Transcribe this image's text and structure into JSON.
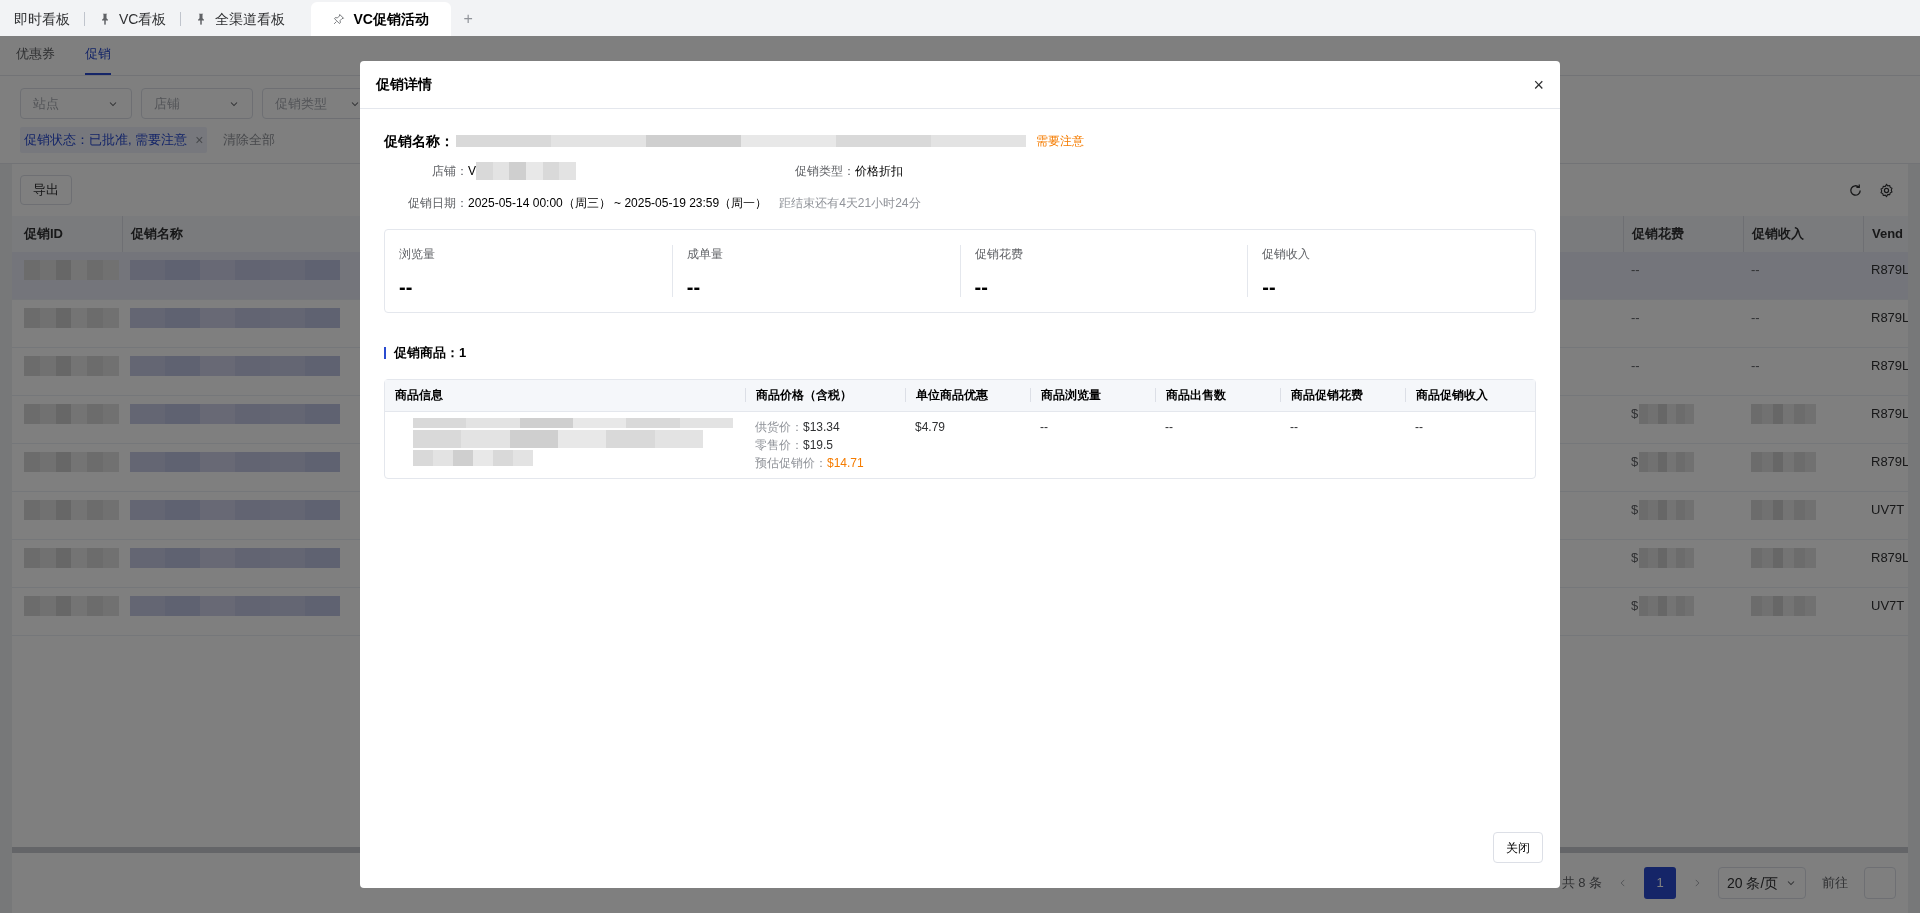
{
  "tabs": [
    {
      "label": "即时看板",
      "selected": false,
      "kind": "plain"
    },
    {
      "label": "VC看板",
      "selected": false,
      "kind": "pinned"
    },
    {
      "label": "全渠道看板",
      "selected": false,
      "kind": "pinned"
    },
    {
      "label": "VC促销活动",
      "selected": true,
      "kind": "unpinned"
    }
  ],
  "add_tab": "+",
  "page": {
    "subtabs": [
      {
        "label": "优惠券",
        "selected": false
      },
      {
        "label": "促销",
        "selected": true
      }
    ],
    "filters": [
      {
        "placeholder": "站点"
      },
      {
        "placeholder": "店铺"
      },
      {
        "placeholder": "促销类型"
      }
    ],
    "active_filter": {
      "text": "促销状态：已批准, 需要注意",
      "remove": "×"
    },
    "clear_all": "清除全部",
    "export": "导出",
    "table": {
      "columns": [
        "促销ID",
        "促销名称",
        "促销花费",
        "促销收入",
        "Vend"
      ],
      "rows": [
        {
          "selected": true,
          "spend": "--",
          "income": "--",
          "vendor": "R879L"
        },
        {
          "selected": false,
          "spend": "--",
          "income": "--",
          "vendor": "R879L"
        },
        {
          "selected": false,
          "spend": "--",
          "income": "--",
          "vendor": "R879L"
        },
        {
          "selected": false,
          "spend": "$",
          "vendor": "R879L"
        },
        {
          "selected": false,
          "spend": "$",
          "vendor": "R879L"
        },
        {
          "selected": false,
          "spend": "$",
          "vendor": "UV7T"
        },
        {
          "selected": false,
          "spend": "$",
          "vendor": "R879L"
        },
        {
          "selected": false,
          "spend": "$",
          "vendor": "UV7T"
        }
      ]
    },
    "pagination": {
      "total": "共 8 条",
      "pages": [
        {
          "label": "1",
          "selected": true
        }
      ],
      "page_size": "20 条/页",
      "goto": "前往"
    }
  },
  "modal": {
    "title": "促销详情",
    "close": "×",
    "name_label": "促销名称：",
    "status": "需要注意",
    "store_label": "店铺：",
    "store_value": "V",
    "type_label": "促销类型：",
    "type_value": "价格折扣",
    "date_label": "促销日期：",
    "date_value": "2025-05-14 00:00（周三） ~ 2025-05-19 23:59（周一）",
    "remaining": "距结束还有4天21小时24分",
    "stats": [
      {
        "label": "浏览量",
        "value": "--"
      },
      {
        "label": "成单量",
        "value": "--"
      },
      {
        "label": "促销花费",
        "value": "--"
      },
      {
        "label": "促销收入",
        "value": "--"
      }
    ],
    "products_title": "促销商品：1",
    "product_table": {
      "columns": [
        "商品信息",
        "商品价格（含税）",
        "单位商品优惠",
        "商品浏览量",
        "商品出售数",
        "商品促销花费",
        "商品促销收入"
      ],
      "rows": [
        {
          "prices": [
            {
              "label": "供货价：",
              "value": "$13.34",
              "kind": "normal"
            },
            {
              "label": "零售价：",
              "value": "$19.5",
              "kind": "normal"
            },
            {
              "label": "预估促销价：",
              "value": "$14.71",
              "kind": "highlight"
            }
          ],
          "discount": "$4.79",
          "views": "--",
          "sold": "--",
          "spend": "--",
          "income": "--"
        }
      ]
    },
    "footer_button": "关闭"
  }
}
